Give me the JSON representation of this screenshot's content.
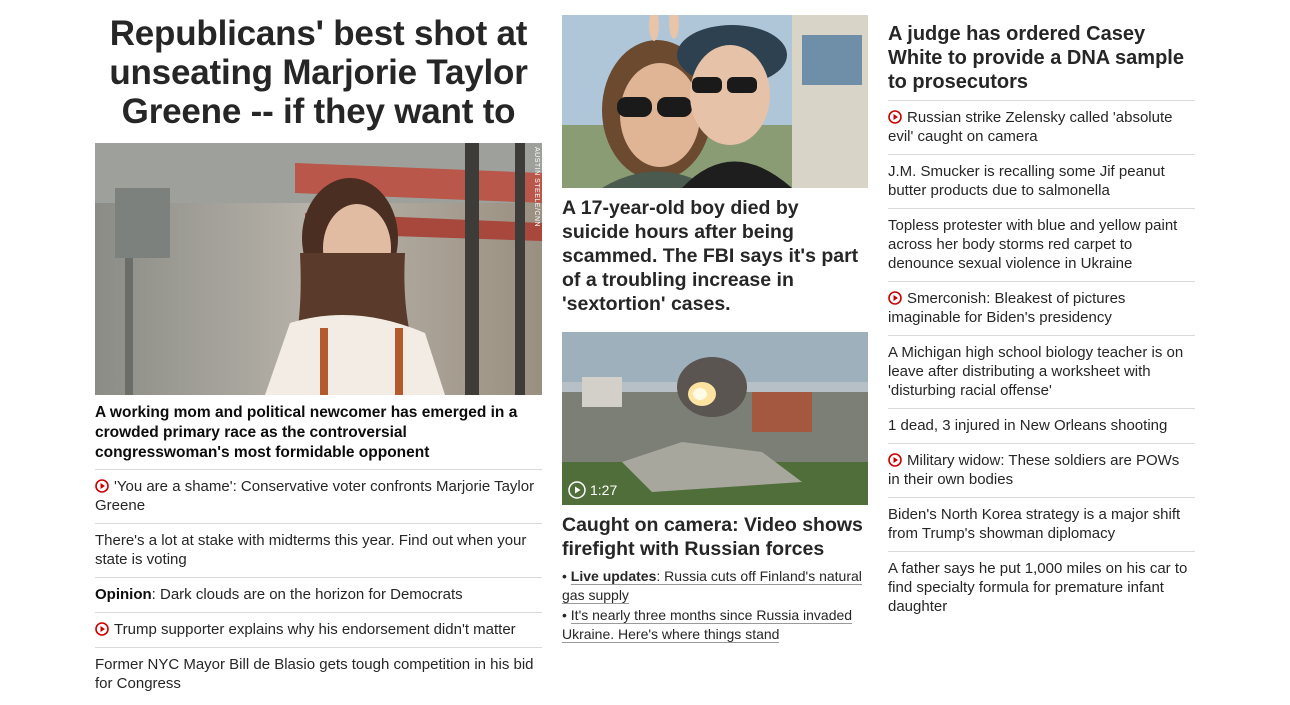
{
  "col1": {
    "headline": "Republicans' best shot at unseating Marjorie Taylor Greene -- if they want to",
    "image_credit": "AUSTIN STEELE/CNN",
    "card_title": "A working mom and political newcomer has emerged in a crowded primary race as the controversial congresswoman's most formidable opponent",
    "items": [
      {
        "video": true,
        "prefix": "",
        "text": "'You are a shame': Conservative voter confronts Marjorie Taylor Greene"
      },
      {
        "video": false,
        "prefix": "",
        "text": "There's a lot at stake with midterms this year. Find out when your state is voting"
      },
      {
        "video": false,
        "prefix": "Opinion",
        "text": ": Dark clouds are on the horizon for Democrats"
      },
      {
        "video": true,
        "prefix": "",
        "text": "Trump supporter explains why his endorsement didn't matter"
      },
      {
        "video": false,
        "prefix": "",
        "text": "Former NYC Mayor Bill de Blasio gets tough competition in his bid for Congress"
      }
    ]
  },
  "col2": {
    "story1_title": "A 17-year-old boy died by suicide hours after being scammed. The FBI says it's part of a troubling increase in 'sextortion' cases.",
    "video_duration": "1:27",
    "story2_title": "Caught on camera: Video shows firefight with Russian forces",
    "bullets": [
      {
        "bold": "Live updates",
        "text": ": Russia cuts off Finland's natural gas supply"
      },
      {
        "bold": "",
        "text": "It's nearly three months since Russia invaded Ukraine. Here's where things stand"
      }
    ]
  },
  "col3": {
    "title": "A judge has ordered Casey White to provide a DNA sample to prosecutors",
    "items": [
      {
        "video": true,
        "text": "Russian strike Zelensky called 'absolute evil' caught on camera"
      },
      {
        "video": false,
        "text": "J.M. Smucker is recalling some Jif peanut butter products due to salmonella"
      },
      {
        "video": false,
        "text": "Topless protester with blue and yellow paint across her body storms red carpet to denounce sexual violence in Ukraine"
      },
      {
        "video": true,
        "text": "Smerconish: Bleakest of pictures imaginable for Biden's presidency"
      },
      {
        "video": false,
        "text": "A Michigan high school biology teacher is on leave after distributing a worksheet with 'disturbing racial offense'"
      },
      {
        "video": false,
        "text": "1 dead, 3 injured in New Orleans shooting"
      },
      {
        "video": true,
        "text": "Military widow: These soldiers are POWs in their own bodies"
      },
      {
        "video": false,
        "text": "Biden's North Korea strategy is a major shift from Trump's showman diplomacy"
      },
      {
        "video": false,
        "text": "A father says he put 1,000 miles on his car to find specialty formula for premature infant daughter"
      }
    ]
  },
  "colors": {
    "video_icon": "#cc0000",
    "divider": "#d9d9d9"
  }
}
